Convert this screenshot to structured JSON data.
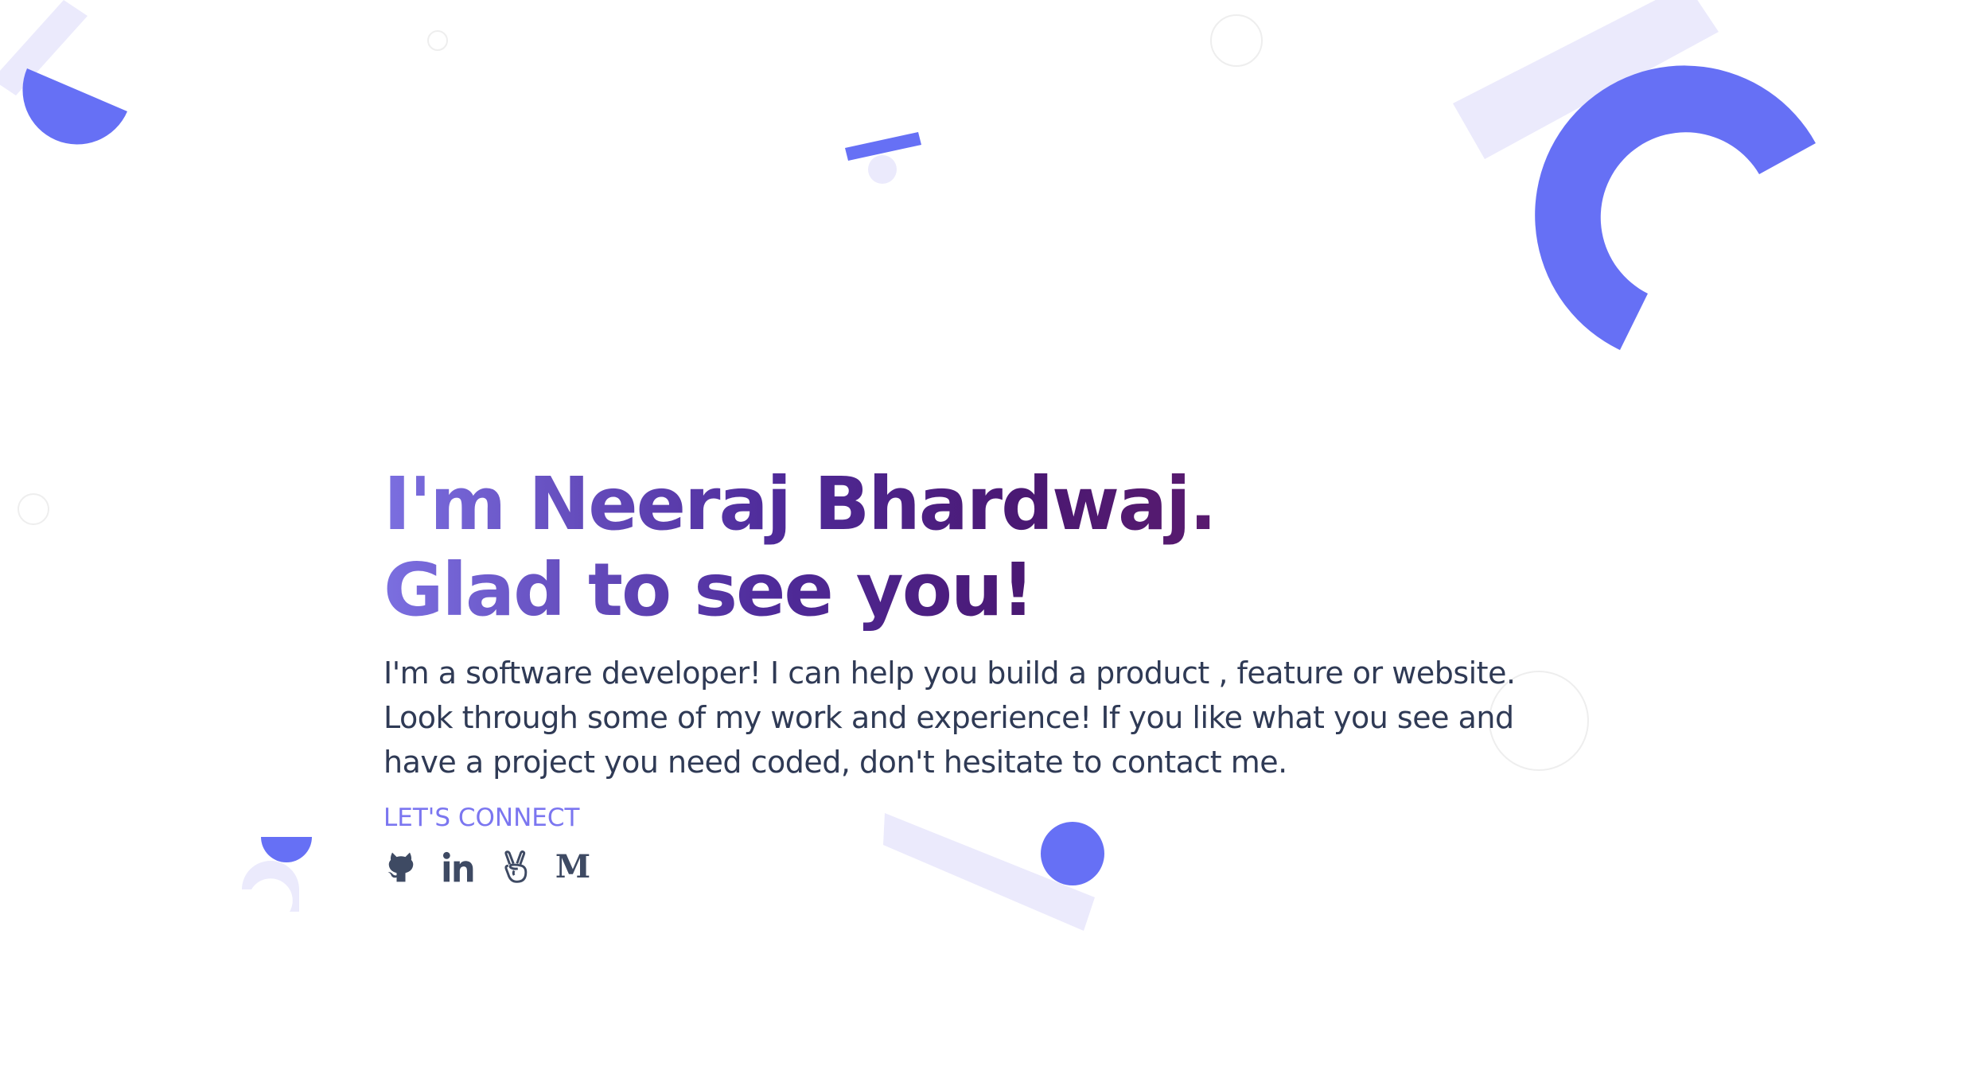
{
  "hero": {
    "headline_line1": "I'm Neeraj Bhardwaj.",
    "headline_line2": "Glad to see you!",
    "intro": "I'm a software developer! I can help you build a product , feature or website. Look through some of my work and experience! If you like what you see and have a project you need coded, don't hesitate to contact me.",
    "connect_label": "LET'S CONNECT"
  },
  "socials": [
    {
      "name": "GitHub",
      "icon": "github-icon"
    },
    {
      "name": "LinkedIn",
      "icon": "linkedin-icon"
    },
    {
      "name": "AngelList",
      "icon": "angellist-icon"
    },
    {
      "name": "Medium",
      "icon": "medium-icon",
      "glyph": "M"
    }
  ],
  "theme": {
    "accent": "#6670f5",
    "accent_light": "#ebeafc",
    "text": "#2f3a55",
    "connect": "#7b76f0",
    "gradient": [
      "#7b6fe0",
      "#4f2b9a",
      "#4a1872",
      "#5b1b6e"
    ]
  }
}
